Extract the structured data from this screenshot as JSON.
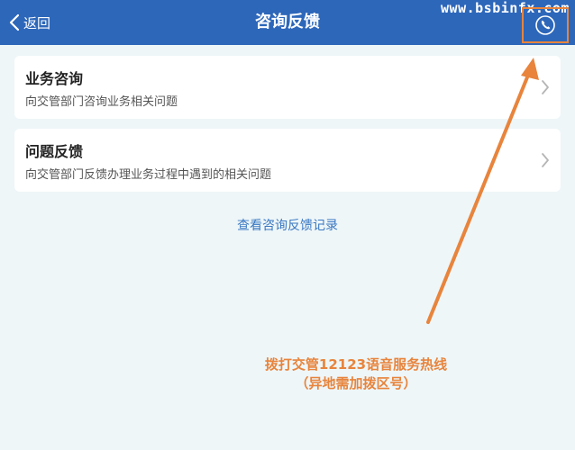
{
  "navbar": {
    "back_label": "返回",
    "title": "咨询反馈",
    "watermark": "www.bsbinfx.com",
    "back_icon": "chevron-left-icon",
    "phone_icon": "phone-icon",
    "bg_color": "#2d67ba"
  },
  "cards": [
    {
      "title": "业务咨询",
      "subtitle": "向交管部门咨询业务相关问题",
      "icon": "chevron-right-icon"
    },
    {
      "title": "问题反馈",
      "subtitle": "向交管部门反馈办理业务过程中遇到的相关问题",
      "icon": "chevron-right-icon"
    }
  ],
  "history_link": "查看咨询反馈记录",
  "annotation": {
    "line1": "拨打交管12123语音服务热线",
    "line2": "（异地需加拨区号）",
    "color": "#e8843c"
  }
}
